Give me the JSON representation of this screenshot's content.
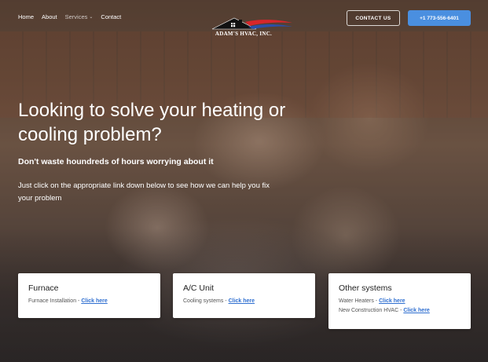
{
  "nav": {
    "links": [
      {
        "label": "Home"
      },
      {
        "label": "About"
      },
      {
        "label": "Services",
        "caret": "⌄"
      },
      {
        "label": "Contact"
      }
    ]
  },
  "logo": {
    "text": "ADAM'S HVAC, INC."
  },
  "header_buttons": {
    "contact_label": "CONTACT US",
    "phone_label": "+1 773-556-6401"
  },
  "hero": {
    "title": "Looking to solve your heating or cooling problem?",
    "subtitle": "Don't waste houndreds of hours worrying about it",
    "body": "Just click on the appropriate link down below to see how we can help you fix your problem"
  },
  "cards": [
    {
      "title": "Furnace",
      "lines": [
        {
          "text": "Furnace Installation - ",
          "link": "Click here"
        }
      ]
    },
    {
      "title": "A/C Unit",
      "lines": [
        {
          "text": "Cooling systems - ",
          "link": "Click here"
        }
      ]
    },
    {
      "title": "Other systems",
      "lines": [
        {
          "text": "Water Heaters - ",
          "link": "Click here"
        },
        {
          "text": "New Construction HVAC - ",
          "link": "Click here"
        }
      ]
    }
  ],
  "colors": {
    "accent": "#4a8fe0",
    "link": "#2f6fd0",
    "logo_red": "#d7262b",
    "logo_blue": "#2a4fa8"
  }
}
